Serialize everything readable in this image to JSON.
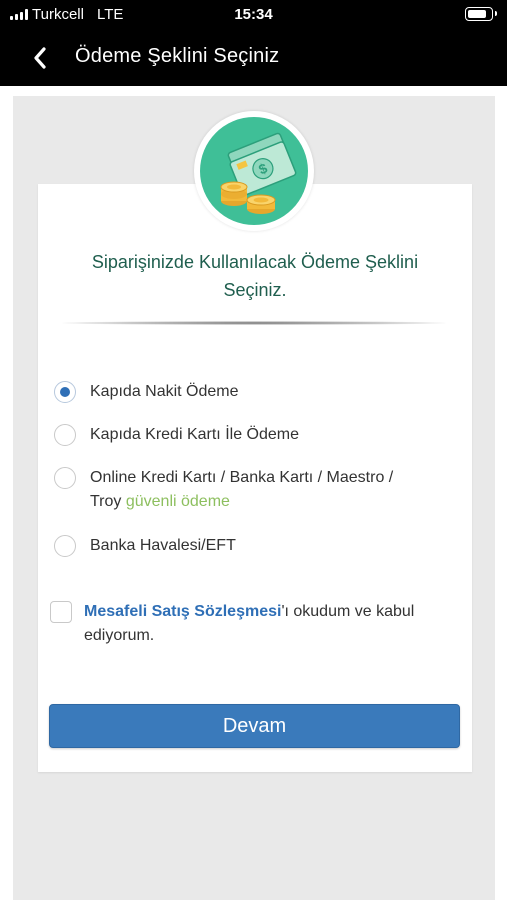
{
  "status_bar": {
    "carrier": "Turkcell",
    "network": "LTE",
    "time": "15:34"
  },
  "nav": {
    "title": "Ödeme Şeklini Seçiniz",
    "back_icon": "chevron-left-icon"
  },
  "hero": {
    "icon": "money-coins-icon",
    "icon_bg_color": "#3fbf97"
  },
  "heading": {
    "line1": "Siparişinizde Kullanılacak Ödeme Şeklini",
    "line2": "Seçiniz."
  },
  "payment_options": [
    {
      "label": "Kapıda Nakit Ödeme",
      "selected": true
    },
    {
      "label": "Kapıda Kredi Kartı İle Ödeme",
      "selected": false
    },
    {
      "label_line1": "Online Kredi Kartı / Banka Kartı / Maestro /",
      "label_line2_prefix": "Troy ",
      "label_line2_highlight": "güvenli ödeme",
      "selected": false
    },
    {
      "label": "Banka Havalesi/EFT",
      "selected": false
    }
  ],
  "agreement": {
    "link_text": "Mesafeli Satış Sözleşmesi",
    "rest_text": "'ı okudum ve kabul ediyorum.",
    "checked": false
  },
  "continue_button": {
    "label": "Devam"
  },
  "colors": {
    "primary_blue": "#3a7abb",
    "heading_green": "#1f5e4e",
    "highlight_green": "#8dbf5f",
    "link_blue": "#2f6fb6"
  }
}
